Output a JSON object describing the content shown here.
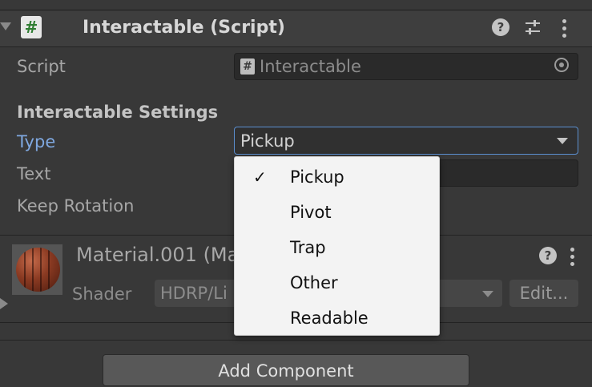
{
  "component": {
    "title": "Interactable (Script)",
    "script_icon_glyph": "#",
    "icons": [
      "help-icon",
      "presets-icon",
      "kebab-menu-icon"
    ]
  },
  "fields": {
    "script_label": "Script",
    "script_value": "Interactable",
    "section_title": "Interactable Settings",
    "type_label": "Type",
    "type_value": "Pickup",
    "text_label": "Text",
    "text_value": "",
    "keep_rotation_label": "Keep Rotation"
  },
  "type_menu": {
    "options": [
      {
        "label": "Pickup",
        "checked": true
      },
      {
        "label": "Pivot",
        "checked": false
      },
      {
        "label": "Trap",
        "checked": false
      },
      {
        "label": "Other",
        "checked": false
      },
      {
        "label": "Readable",
        "checked": false
      }
    ],
    "check_glyph": "✓"
  },
  "material": {
    "name": "Material.001 (Ma",
    "shader_label": "Shader",
    "shader_value": "HDRP/Li",
    "edit_label": "Edit..."
  },
  "add_component_label": "Add Component",
  "colors": {
    "background": "#383838",
    "focus_outline": "#5b8fd0",
    "active_label": "#7fa8e0",
    "menu_background": "#f3f3f3"
  }
}
